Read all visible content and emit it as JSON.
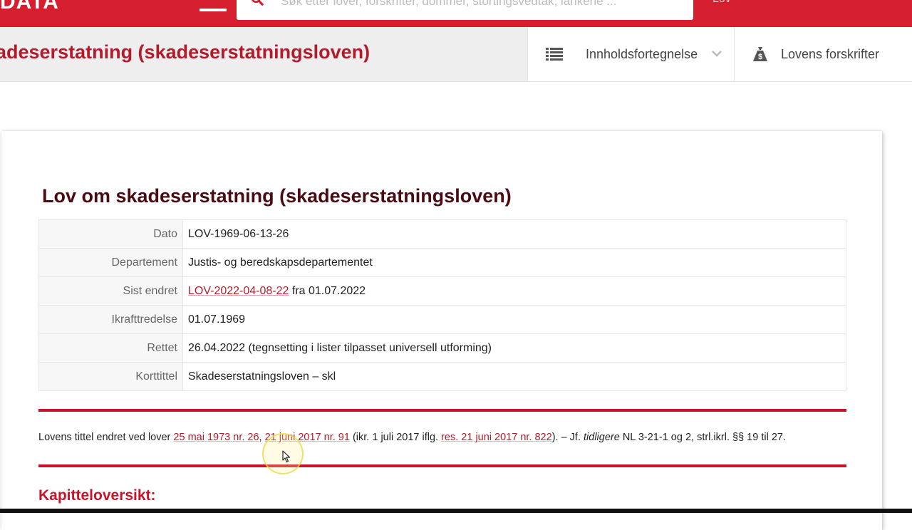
{
  "topbar": {
    "logo": "DATA",
    "search_placeholder": "Søk etter lover, forskrifter, dommer, stortingsvedtak, lankene ...",
    "right_text": "Lov"
  },
  "subheader": {
    "law_title": "adeserstatning (skadeserstatningsloven)",
    "toc_label": "Innholdsfortegnelse",
    "regs_label": "Lovens forskrifter"
  },
  "document": {
    "title": "Lov om skadeserstatning (skadeserstatningsloven)",
    "metadata": [
      {
        "key": "Dato",
        "value": "LOV-1969-06-13-26"
      },
      {
        "key": "Departement",
        "value": "Justis- og beredskapsdepartementet"
      },
      {
        "key": "Sist endret",
        "link": "LOV-2022-04-08-22",
        "value": " fra 01.07.2022"
      },
      {
        "key": "Ikrafttredelse",
        "value": "01.07.1969"
      },
      {
        "key": "Rettet",
        "value": "26.04.2022 (tegnsetting i lister tilpasset universell utforming)"
      },
      {
        "key": "Korttittel",
        "value": "Skadeserstatningsloven – skl"
      }
    ],
    "note": {
      "prefix": "Lovens tittel endret ved lover ",
      "link1": "25 mai 1973 nr. 26",
      "sep1": ", ",
      "link2": "21 juni 2017 nr. 91",
      "mid": " (ikr. 1 juli 2017 iflg. ",
      "link3": "res. 21 juni 2017 nr. 822",
      "after": "). – Jf. ",
      "italic": "tidligere",
      "suffix": " NL 3-21-1 og 2, strl.ikrl. §§ 19 til 27."
    },
    "chapter_heading": "Kapitteloversikt:"
  },
  "colors": {
    "brand_red": "#d51f2f",
    "title_red": "#b31b2c",
    "dark_title": "#4a0b12"
  },
  "icons": {
    "search": "search-icon",
    "toc": "list-icon",
    "chevron": "chevron-down-icon",
    "regulations": "money-bag-icon"
  }
}
